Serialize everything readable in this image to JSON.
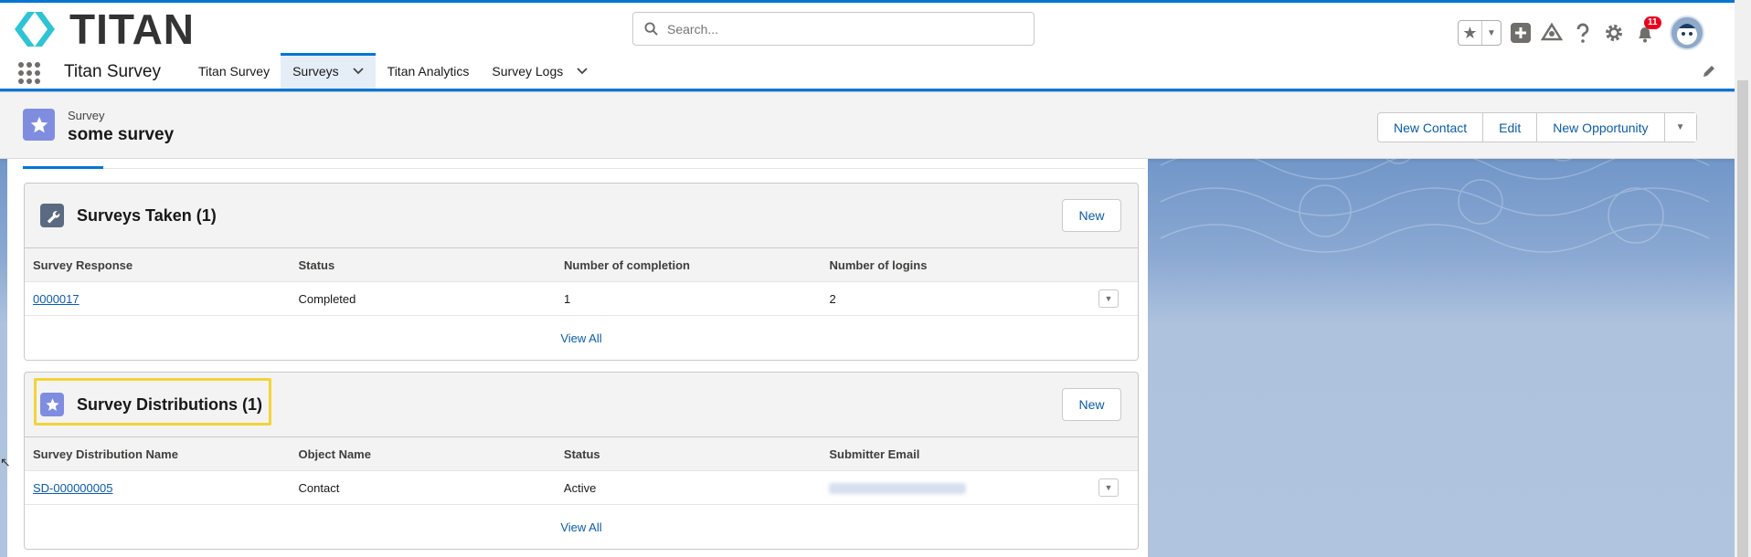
{
  "colors": {
    "brand_blue": "#0176d3",
    "link": "#0b5cab",
    "survey_icon": "#7f8de1",
    "wrench_icon": "#5a6a82",
    "badge_red": "#ea001e",
    "highlight": "#f2d43a"
  },
  "header": {
    "logo_text": "TITAN",
    "search_placeholder": "Search...",
    "notification_count": "11"
  },
  "nav": {
    "app_name": "Titan Survey",
    "items": [
      {
        "label": "Titan Survey"
      },
      {
        "label": "Surveys"
      },
      {
        "label": "Titan Analytics"
      },
      {
        "label": "Survey Logs"
      }
    ]
  },
  "record": {
    "type": "Survey",
    "title": "some survey",
    "actions": [
      "New Contact",
      "Edit",
      "New Opportunity"
    ]
  },
  "surveys_taken": {
    "title": "Surveys Taken (1)",
    "new_label": "New",
    "columns": [
      "Survey Response",
      "Status",
      "Number of completion",
      "Number of logins"
    ],
    "rows": [
      {
        "response": "0000017",
        "status": "Completed",
        "completion": "1",
        "logins": "2"
      }
    ],
    "view_all": "View All"
  },
  "survey_distributions": {
    "title": "Survey Distributions (1)",
    "new_label": "New",
    "columns": [
      "Survey Distribution Name",
      "Object Name",
      "Status",
      "Submitter Email"
    ],
    "rows": [
      {
        "name": "SD-000000005",
        "object": "Contact",
        "status": "Active"
      }
    ],
    "view_all": "View All"
  }
}
